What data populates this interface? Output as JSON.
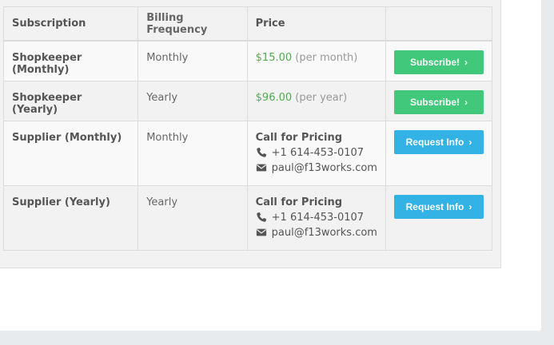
{
  "table": {
    "headers": [
      "Subscription",
      "Billing Frequency",
      "Price",
      ""
    ],
    "rows": [
      {
        "subscription": "Shopkeeper (Monthly)",
        "frequency": "Monthly",
        "price": "$15.00",
        "price_note": "(per month)",
        "button": "Subscribe!"
      },
      {
        "subscription": "Shopkeeper (Yearly)",
        "frequency": "Yearly",
        "price": "$96.00",
        "price_note": "(per year)",
        "button": "Subscribe!"
      },
      {
        "subscription": "Supplier (Monthly)",
        "frequency": "Monthly",
        "price_call": "Call for Pricing",
        "phone": "+1 614-453-0107",
        "email": "paul@f13works.com",
        "button": "Request Info"
      },
      {
        "subscription": "Supplier (Yearly)",
        "frequency": "Yearly",
        "price_call": "Call for Pricing",
        "phone": "+1 614-453-0107",
        "email": "paul@f13works.com",
        "button": "Request Info"
      }
    ]
  },
  "icons": {
    "phone": "phone-icon",
    "email": "envelope-icon",
    "button_chevron": "chevron-right-icon"
  },
  "colors": {
    "subscribe_button": "#41c87a",
    "request_button": "#33b2e6",
    "price_green": "#4cae4c"
  }
}
